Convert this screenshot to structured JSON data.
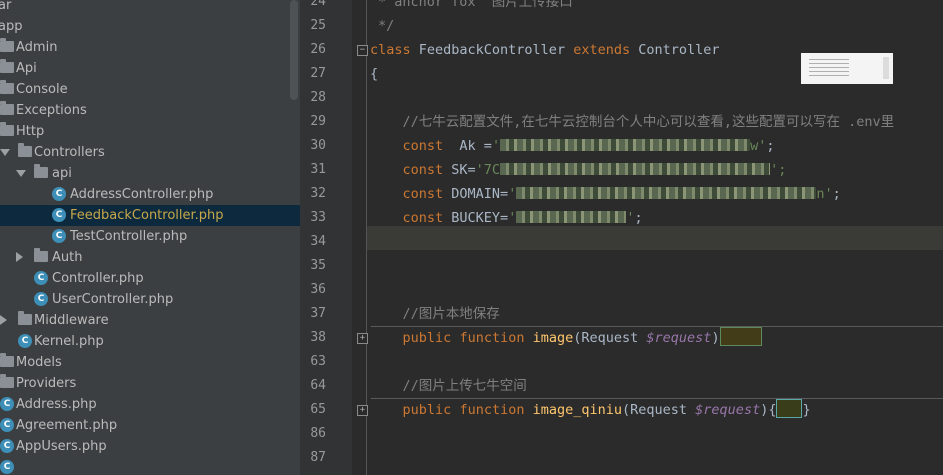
{
  "project_tree": {
    "items": [
      {
        "label": "ar",
        "type": "none",
        "depth": 0
      },
      {
        "label": "app",
        "type": "none",
        "depth": 0
      },
      {
        "label": "Admin",
        "type": "folder",
        "depth": 1
      },
      {
        "label": "Api",
        "type": "folder",
        "depth": 1
      },
      {
        "label": "Console",
        "type": "folder",
        "depth": 1
      },
      {
        "label": "Exceptions",
        "type": "folder",
        "depth": 1
      },
      {
        "label": "Http",
        "type": "folder",
        "depth": 1
      },
      {
        "label": "Controllers",
        "type": "folder-open",
        "depth": 2
      },
      {
        "label": "api",
        "type": "folder-open",
        "depth": 3
      },
      {
        "label": "AddressController.php",
        "type": "class",
        "depth": 4
      },
      {
        "label": "FeedbackController.php",
        "type": "class",
        "depth": 4,
        "selected": true
      },
      {
        "label": "TestController.php",
        "type": "class",
        "depth": 4
      },
      {
        "label": "Auth",
        "type": "folder-closed",
        "depth": 3
      },
      {
        "label": "Controller.php",
        "type": "class",
        "depth": 3
      },
      {
        "label": "UserController.php",
        "type": "class",
        "depth": 3
      },
      {
        "label": "Middleware",
        "type": "folder-closed",
        "depth": 2
      },
      {
        "label": "Kernel.php",
        "type": "class",
        "depth": 2
      },
      {
        "label": "Models",
        "type": "folder",
        "depth": 1
      },
      {
        "label": "Providers",
        "type": "folder",
        "depth": 1
      },
      {
        "label": "Address.php",
        "type": "class",
        "depth": 1
      },
      {
        "label": "Agreement.php",
        "type": "class",
        "depth": 1
      },
      {
        "label": "AppUsers.php",
        "type": "class",
        "depth": 1
      },
      {
        "label": "",
        "type": "class",
        "depth": 1
      }
    ],
    "class_icon_glyph": "C",
    "colors": {
      "selected_bg": "#0d293e",
      "selected_text": "#c7a84a",
      "class_icon": "#3d8fb8"
    }
  },
  "editor": {
    "line_numbers": [
      "24",
      "25",
      "26",
      "27",
      "28",
      "29",
      "30",
      "31",
      "32",
      "33",
      "34",
      "35",
      "36",
      "37",
      "38",
      "63",
      "64",
      "65",
      "86",
      "87"
    ],
    "current_line": "34",
    "code": {
      "l24": "anchor fox  图片上传接口",
      "l25": "*/",
      "l26_kw": "class",
      "l26_name": " FeedbackController ",
      "l26_ext": "extends",
      "l26_parent": " Controller",
      "l27": "{",
      "l29_comment": "//七牛云配置文件,在七牛云控制台个人中心可以查看,这些配置可以写在 .env里",
      "l30_kw": "const",
      "l30_rest": "  Ak =",
      "l30_str_start": "'",
      "l30_str_end": "w'",
      "l31_kw": "const",
      "l31_rest": " SK=",
      "l31_str_start": "'7C",
      "l31_str_end": "';",
      "l32_kw": "const",
      "l32_rest": " DOMAIN=",
      "l32_str_start": "'",
      "l32_str_end": "n'",
      "l33_kw": "const",
      "l33_rest": " BUCKEY=",
      "l33_str_start": "'",
      "l33_str_end": "'",
      "semicolon": ";",
      "l37_comment": "//图片本地保存",
      "l38_public": "public",
      "l38_function": "function",
      "l38_name": "image",
      "l38_params": "(Request ",
      "l38_var": "$request",
      "l38_close": ")",
      "l64_comment": "//图片上传七牛空间",
      "l65_public": "public",
      "l65_function": "function",
      "l65_name": "image_qiniu",
      "l65_params": "(Request ",
      "l65_var": "$request",
      "l65_close": "){",
      "l65_end": "}"
    },
    "colors": {
      "keyword": "#cc7832",
      "comment": "#808080",
      "string": "#6a8759",
      "variable": "#9876aa",
      "function": "#ffc66d"
    }
  }
}
